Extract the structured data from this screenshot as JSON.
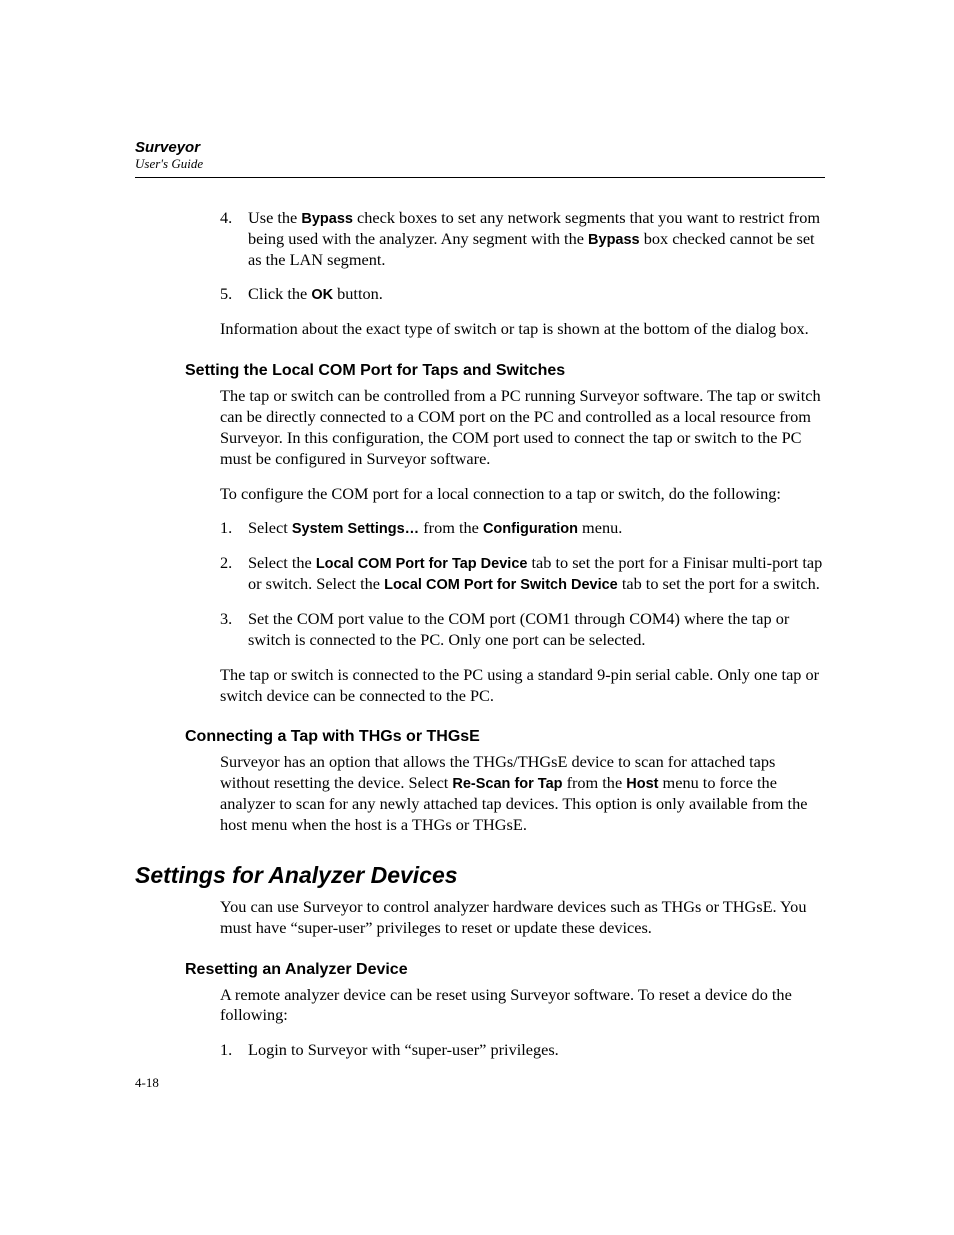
{
  "header": {
    "title": "Surveyor",
    "subtitle": "User's Guide"
  },
  "topList": {
    "item4": {
      "num": "4.",
      "t1": "Use the ",
      "b1": "Bypass",
      "t2": " check boxes to set any network segments that you want to restrict from being used with the analyzer. Any segment with the ",
      "b2": "Bypass",
      "t3": " box checked cannot be set as the LAN segment."
    },
    "item5": {
      "num": "5.",
      "t1": "Click the ",
      "b1": "OK",
      "t2": " button."
    }
  },
  "afterTopList": "Information about the exact type of switch or tap is shown at the bottom of the dialog box.",
  "section1": {
    "heading": "Setting the Local COM Port for Taps and Switches",
    "p1": "The tap or switch can be controlled from a PC running Surveyor software. The tap or switch can be directly connected to a COM port on the PC and controlled as a local resource from Surveyor. In this configuration, the COM port used to connect the tap or switch to the PC must be configured in Surveyor software.",
    "p2": "To configure the COM port for a local connection to a tap or switch, do the following:",
    "list": {
      "i1": {
        "num": "1.",
        "t1": "Select ",
        "b1": "System Settings…",
        "t2": " from the ",
        "b2": "Configuration",
        "t3": " menu."
      },
      "i2": {
        "num": "2.",
        "t1": "Select the ",
        "b1": "Local COM Port for Tap Device",
        "t2": " tab to set the port for a Finisar multi-port tap or switch. Select the ",
        "b2": "Local COM Port for Switch Device",
        "t3": " tab to set the port for a switch."
      },
      "i3": {
        "num": "3.",
        "t1": "Set the COM port value to the COM port (COM1 through COM4) where the tap or switch is connected to the PC. Only one port can be selected."
      }
    },
    "p3": "The tap or switch is connected to the PC using a standard 9-pin serial cable. Only one tap or switch device can be connected to the PC."
  },
  "section2": {
    "heading": "Connecting a Tap with THGs or THGsE",
    "p1_a": "Surveyor has an option that allows the THGs/THGsE device to scan for attached taps without resetting the device. Select ",
    "p1_b1": "Re-Scan for Tap",
    "p1_b": " from the ",
    "p1_b2": "Host",
    "p1_c": " menu to force the analyzer to scan for any newly attached tap devices. This option is only available from the host menu when the host is a THGs or THGsE."
  },
  "section3": {
    "heading": "Settings for Analyzer Devices",
    "p1": "You can use Surveyor to control analyzer hardware devices such as THGs or THGsE. You must have “super-user” privileges to reset or update these devices."
  },
  "section4": {
    "heading": "Resetting an Analyzer Device",
    "p1": "A remote analyzer device can be reset using Surveyor software. To reset a device do the following:",
    "list": {
      "i1": {
        "num": "1.",
        "t1": "Login to Surveyor with “super-user” privileges."
      }
    }
  },
  "pageNumber": "4-18"
}
